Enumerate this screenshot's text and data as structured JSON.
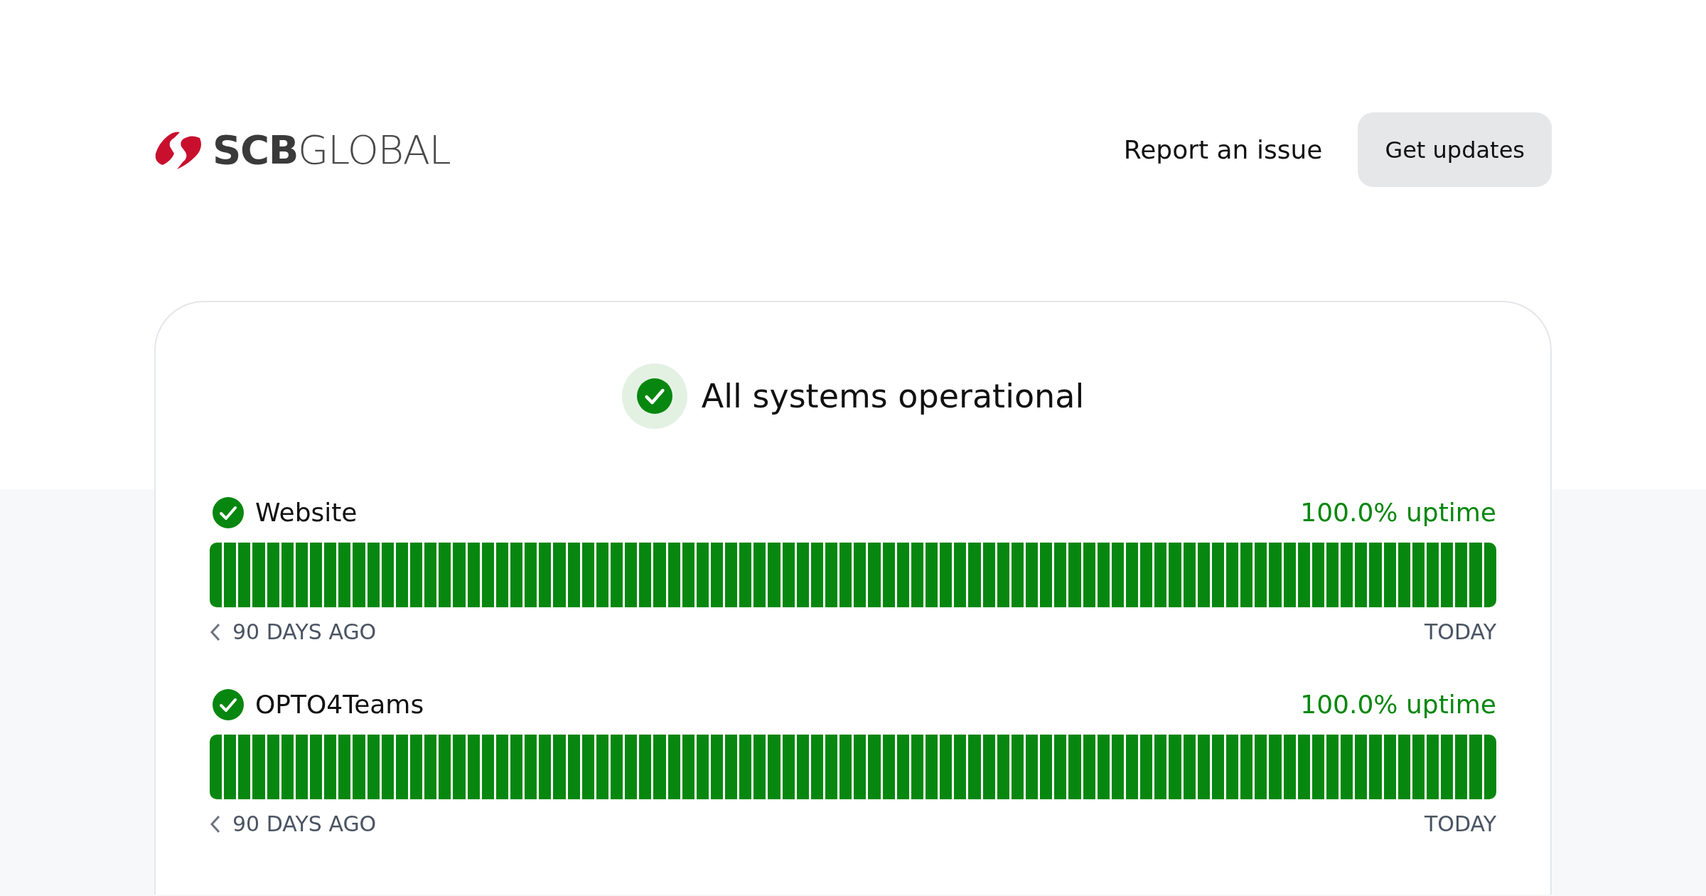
{
  "header": {
    "logo": {
      "bold": "SCB",
      "light": "GLOBAL"
    },
    "links": [
      {
        "label": "Report an issue",
        "kind": "link"
      },
      {
        "label": "Get updates",
        "kind": "button"
      }
    ]
  },
  "overall": {
    "operational": true,
    "text": "All systems operational"
  },
  "components": [
    {
      "name": "Website",
      "operational": true,
      "uptime": "100.0% uptime",
      "start": "90 DAYS AGO",
      "end": "TODAY"
    },
    {
      "name": "OPTO4Teams",
      "operational": true,
      "uptime": "100.0% uptime",
      "start": "90 DAYS AGO",
      "end": "TODAY"
    }
  ]
}
